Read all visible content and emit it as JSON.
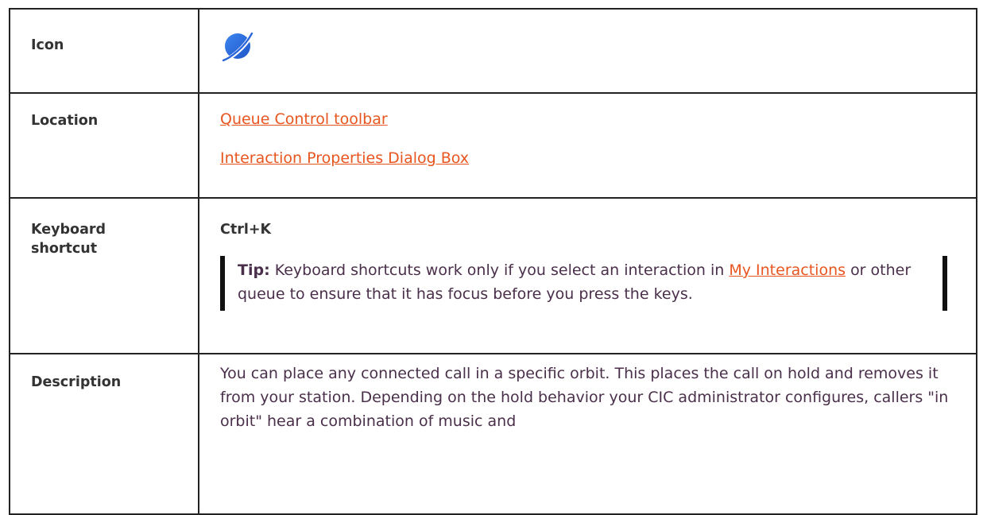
{
  "rows": {
    "icon": {
      "label": "Icon",
      "icon_name": "orbit-planet-icon",
      "icon_color": "#2f6fe0"
    },
    "location": {
      "label": "Location",
      "links": [
        "Queue Control toolbar",
        "Interaction Properties Dialog Box"
      ]
    },
    "shortcut": {
      "label_line1": "Keyboard",
      "label_line2": "shortcut",
      "keys": "Ctrl+K",
      "tip": {
        "label": "Tip:",
        "text_before": "Keyboard shortcuts work only if you select an interaction in",
        "link": "My Interactions",
        "text_after": "or other queue to ensure that it has focus before you press the keys."
      }
    },
    "description": {
      "label": "Description",
      "text": "You can place any connected call in a specific orbit. This places the call on hold and removes it from your station. Depending on the hold behavior your CIC administrator configures, callers \"in orbit\" hear a combination of music and"
    }
  },
  "colors": {
    "link": "#e8551f",
    "body_text": "#4a2f4a",
    "label_text": "#333333",
    "border": "#222222"
  }
}
